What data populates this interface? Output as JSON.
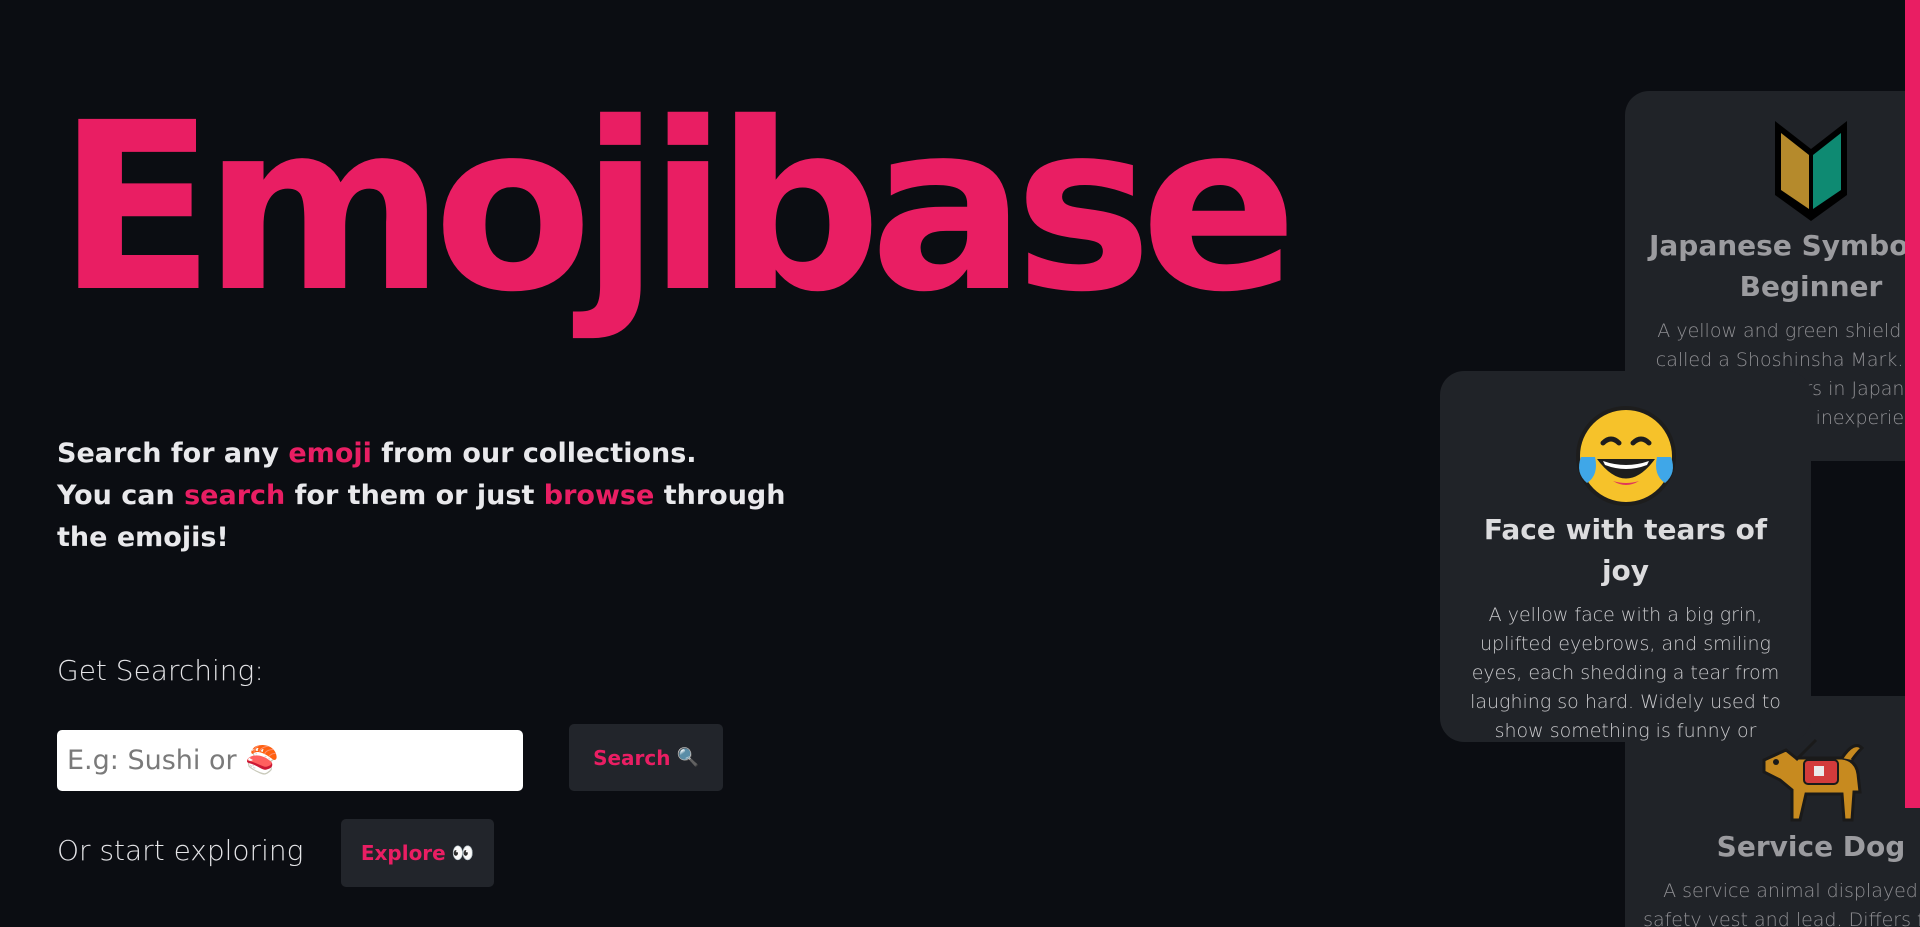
{
  "app": {
    "title": "Emojibase",
    "brand_color": "#e91e63",
    "background_color": "#0b0d12"
  },
  "tagline": {
    "line1_pre": "Search for any ",
    "line1_accent": "emoji",
    "line1_post": " from our collections.",
    "line2_pre": "You can ",
    "line2_accent1": "search",
    "line2_mid": " for them or just ",
    "line2_accent2": "browse",
    "line2_post": " through the emojis!"
  },
  "search": {
    "heading": "Get Searching:",
    "placeholder": "E.g: Sushi or 🍣",
    "value": "",
    "button_label": "Search",
    "button_icon": "magnifying-glass-icon"
  },
  "explore": {
    "prompt": "Or start exploring",
    "button_label": "Explore",
    "button_icon": "eyes-icon"
  },
  "cards": {
    "japanese": {
      "emoji_icon": "japanese-beginner-symbol-icon",
      "title": "Japanese Symbol for Beginner",
      "description": "A yellow and green shield shape called a Shoshinsha Mark. Marks beginner drivers in Japan, who perceive their inexperience."
    },
    "joy": {
      "emoji_icon": "face-with-tears-of-joy-icon",
      "title": "Face with tears of joy",
      "description": "A yellow face with a big grin, uplifted eyebrows, and smiling eyes, each shedding a tear from laughing so hard. Widely used to show something is funny or pleasing."
    },
    "servicedog": {
      "emoji_icon": "service-dog-icon",
      "title": "Service Dog",
      "description": "A service animal displayed in a safety vest and lead. Differs from a dog."
    }
  }
}
